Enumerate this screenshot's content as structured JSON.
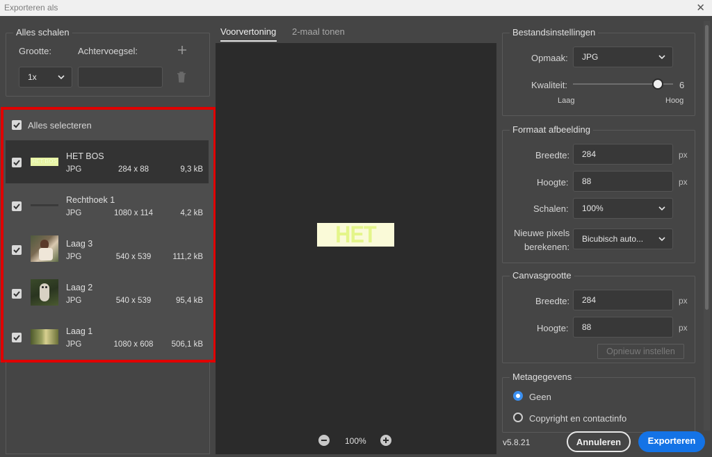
{
  "window": {
    "title": "Exporteren als"
  },
  "scale_panel": {
    "legend": "Alles schalen",
    "size_label": "Grootte:",
    "suffix_label": "Achtervoegsel:",
    "size_value": "1x",
    "suffix_value": ""
  },
  "layers": {
    "select_all_label": "Alles selecteren",
    "items": [
      {
        "name": "HET BOS",
        "format": "JPG",
        "dimensions": "284 x 88",
        "size": "9,3 kB",
        "checked": true,
        "selected": true
      },
      {
        "name": "Rechthoek 1",
        "format": "JPG",
        "dimensions": "1080 x 114",
        "size": "4,2 kB",
        "checked": true,
        "selected": false
      },
      {
        "name": "Laag 3",
        "format": "JPG",
        "dimensions": "540 x 539",
        "size": "111,2 kB",
        "checked": true,
        "selected": false
      },
      {
        "name": "Laag 2",
        "format": "JPG",
        "dimensions": "540 x 539",
        "size": "95,4 kB",
        "checked": true,
        "selected": false
      },
      {
        "name": "Laag 1",
        "format": "JPG",
        "dimensions": "1080 x 608",
        "size": "506,1 kB",
        "checked": true,
        "selected": false
      }
    ],
    "highlight_color": "#e00000"
  },
  "preview": {
    "tabs": [
      "Voorvertoning",
      "2-maal tonen"
    ],
    "active_tab": "Voorvertoning",
    "image_text": "HET BOS",
    "zoom": "100%"
  },
  "file_settings": {
    "legend": "Bestandsinstellingen",
    "format_label": "Opmaak:",
    "format_value": "JPG",
    "quality_label": "Kwaliteit:",
    "quality_value": "6",
    "quality_fraction": 0.89,
    "quality_low": "Laag",
    "quality_high": "Hoog"
  },
  "image_size": {
    "legend": "Formaat afbeelding",
    "width_label": "Breedte:",
    "width_value": "284",
    "height_label": "Hoogte:",
    "height_value": "88",
    "unit": "px",
    "scale_label": "Schalen:",
    "scale_value": "100%",
    "resample_label_1": "Nieuwe pixels",
    "resample_label_2": "berekenen:",
    "resample_value": "Bicubisch auto..."
  },
  "canvas_size": {
    "legend": "Canvasgrootte",
    "width_label": "Breedte:",
    "width_value": "284",
    "height_label": "Hoogte:",
    "height_value": "88",
    "unit": "px",
    "reset_label": "Opnieuw instellen"
  },
  "metadata": {
    "legend": "Metagegevens",
    "options": [
      "Geen",
      "Copyright en contactinfo"
    ],
    "selected": "Geen"
  },
  "footer": {
    "version": "v5.8.21",
    "cancel_label": "Annuleren",
    "export_label": "Exporteren",
    "accent": "#1473e6"
  }
}
